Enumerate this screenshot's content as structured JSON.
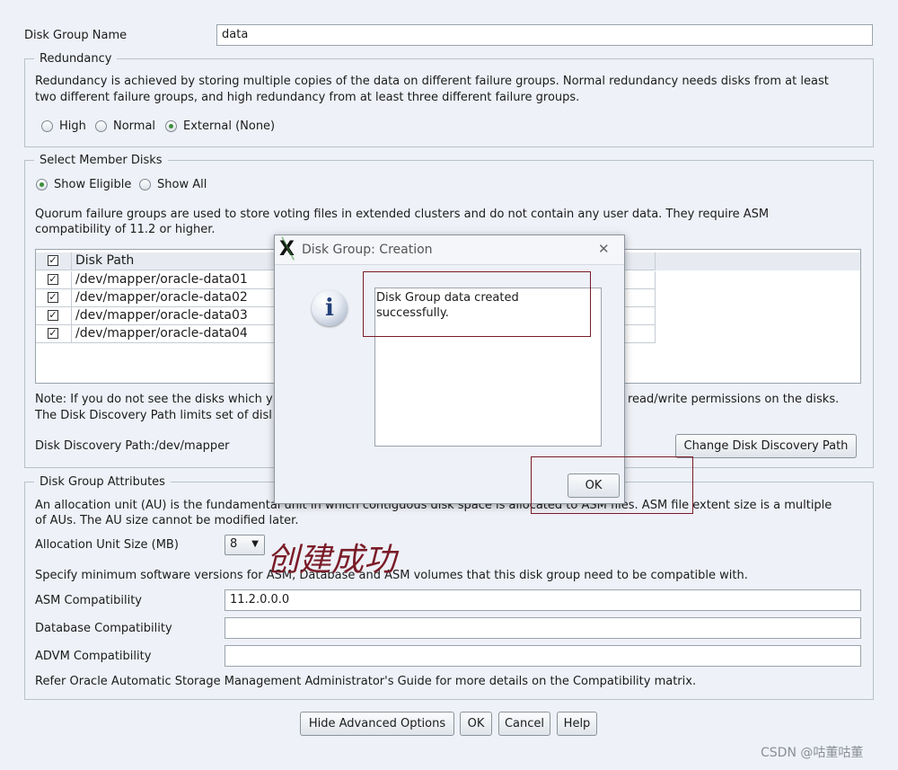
{
  "disk_group_name": {
    "label": "Disk Group Name",
    "value": "data"
  },
  "redundancy": {
    "legend": "Redundancy",
    "description_line1": "Redundancy is achieved by storing multiple copies of the data on different failure groups. Normal redundancy needs disks from at least",
    "description_line2": "two different failure groups, and high redundancy from at least three different failure groups.",
    "options": [
      "High",
      "Normal",
      "External (None)"
    ],
    "selected": "External (None)"
  },
  "member_disks": {
    "legend": "Select Member Disks",
    "filter_options": [
      "Show Eligible",
      "Show All"
    ],
    "filter_selected": "Show Eligible",
    "quorum_line1": "Quorum failure groups are used to store voting files in extended clusters and do not contain any user data. They require ASM",
    "quorum_line2": "compatibility of 11.2 or higher.",
    "table_header": "Disk Path",
    "disks": [
      "/dev/mapper/oracle-data01",
      "/dev/mapper/oracle-data02",
      "/dev/mapper/oracle-data03",
      "/dev/mapper/oracle-data04"
    ],
    "note_line1_left": "Note: If you do not see the disks which y",
    "note_line1_right": "read/write permissions on the disks.",
    "note_line2_left": "The Disk Discovery Path limits set of disl",
    "discovery_path": "Disk Discovery Path:/dev/mapper",
    "change_path_button": "Change Disk Discovery Path"
  },
  "attributes": {
    "legend": "Disk Group Attributes",
    "au_line1_left": "An allocation unit (AU) is the fundamental unit in which contiguous disk space is allocated to ASM files. ASM file extent size is a multiple",
    "au_line2": "of AUs. The AU size cannot be modified later.",
    "au_size_label": "Allocation Unit Size (MB)",
    "au_size_value": "8",
    "compat_intro": "Specify minimum software versions for ASM, Database and ASM volumes that this disk group need to be compatible with.",
    "asm_compat_label": "ASM Compatibility",
    "asm_compat_value": "11.2.0.0.0",
    "db_compat_label": "Database Compatibility",
    "db_compat_value": "",
    "advm_compat_label": "ADVM Compatibility",
    "advm_compat_value": "",
    "refer_text": "Refer Oracle Automatic Storage Management Administrator's Guide for more details on the Compatibility matrix."
  },
  "bottom_buttons": {
    "hide_advanced": "Hide Advanced Options",
    "ok": "OK",
    "cancel": "Cancel",
    "help": "Help"
  },
  "dialog": {
    "title": "Disk Group: Creation",
    "close_glyph": "✕",
    "message_line1": "Disk Group data created",
    "message_line2": "successfully.",
    "ok_button": "OK",
    "info_glyph": "i",
    "app_glyph": "X"
  },
  "annotation": "创建成功",
  "watermark": "CSDN @咕董咕董",
  "colors": {
    "annotation_red": "#7a1c28",
    "accent_green": "#3b8f3b"
  }
}
